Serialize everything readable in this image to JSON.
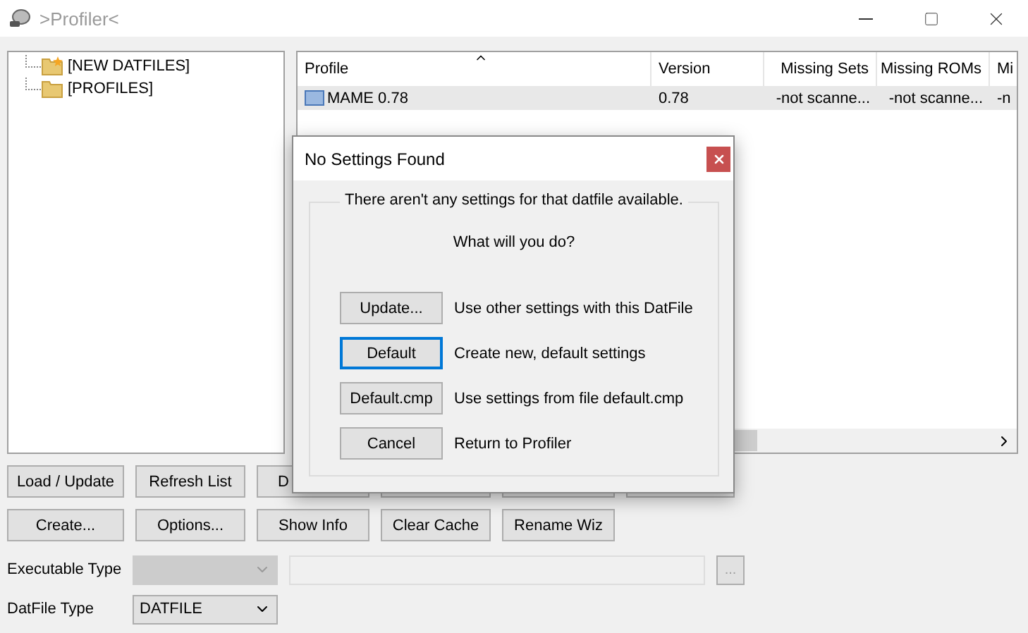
{
  "window": {
    "title": ">Profiler<"
  },
  "tree": {
    "items": [
      {
        "label": "[NEW DATFILES]",
        "kind": "new_folder"
      },
      {
        "label": "[PROFILES]",
        "kind": "folder"
      }
    ]
  },
  "profile_list": {
    "columns": [
      {
        "label": "Profile",
        "sorted": true
      },
      {
        "label": "Version",
        "sorted": false
      },
      {
        "label": "Missing Sets",
        "sorted": false
      },
      {
        "label": "Missing ROMs",
        "sorted": false
      },
      {
        "label": "Mi",
        "sorted": false
      }
    ],
    "rows": [
      {
        "selected": true,
        "cells": [
          "MAME 0.78",
          "0.78",
          "-not scanne...",
          "-not scanne...",
          "-n"
        ]
      }
    ]
  },
  "button_rows": [
    [
      {
        "label": "Load / Update"
      },
      {
        "label": "Refresh List"
      },
      {
        "label": "D"
      }
    ],
    [
      {
        "label": "Create..."
      },
      {
        "label": "Options..."
      },
      {
        "label": "Show Info"
      },
      {
        "label": "Clear Cache"
      },
      {
        "label": "Rename Wiz"
      }
    ]
  ],
  "executable_type": {
    "label": "Executable Type",
    "disabled": true,
    "browse": "..."
  },
  "datfile_type": {
    "label": "DatFile Type",
    "value": "DATFILE",
    "disabled": false
  },
  "dialog": {
    "title": "No Settings Found",
    "message": "There aren't any settings for that datfile available.",
    "question": "What will you do?",
    "options": [
      {
        "button": "Update...",
        "description": "Use other settings with this DatFile",
        "default": false
      },
      {
        "button": "Default",
        "description": "Create new, default settings",
        "default": true
      },
      {
        "button": "Default.cmp",
        "description": "Use settings from file default.cmp",
        "default": false
      },
      {
        "button": "Cancel",
        "description": "Return to Profiler",
        "default": false
      }
    ]
  }
}
